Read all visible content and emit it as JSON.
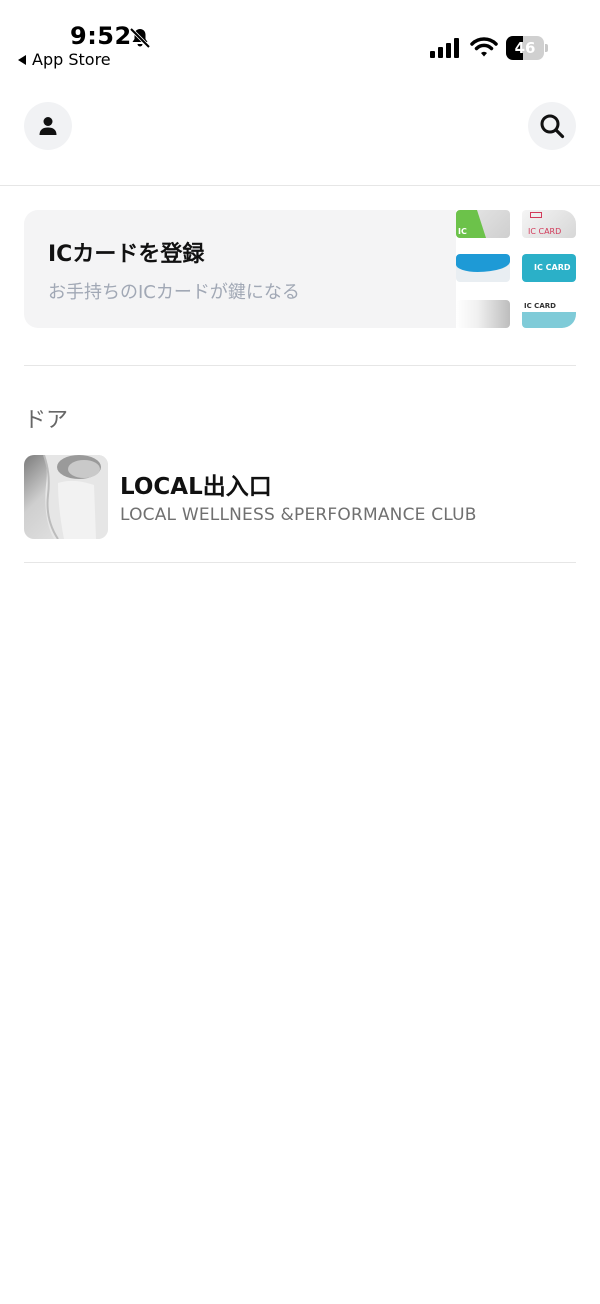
{
  "status_bar": {
    "time": "9:52",
    "back_label": "App Store",
    "battery_level": "46",
    "battery_fraction": 0.46,
    "icons": [
      "bell-slash-icon",
      "cellular-signal-icon",
      "wifi-icon",
      "battery-icon"
    ]
  },
  "header": {
    "profile_icon": "person-icon",
    "search_icon": "magnifier-icon"
  },
  "ic_banner": {
    "title": "ICカードを登録",
    "subtitle": "お手持ちのICカードが鍵になる",
    "card_labels": [
      "IC",
      "IC CARD",
      "IC CARD",
      "IC CARD"
    ]
  },
  "doors_section": {
    "title": "ドア",
    "items": [
      {
        "name": "LOCAL出入口",
        "subtitle": "LOCAL WELLNESS &PERFORMANCE CLUB"
      }
    ]
  },
  "colors": {
    "background": "#ffffff",
    "card_bg": "#f4f4f5",
    "subtitle_gray": "#a1a8b5",
    "accent_blue": "#1e9ad6",
    "accent_green": "#6cc24a",
    "accent_teal": "#2bb0c8",
    "accent_red": "#d23a5a"
  }
}
